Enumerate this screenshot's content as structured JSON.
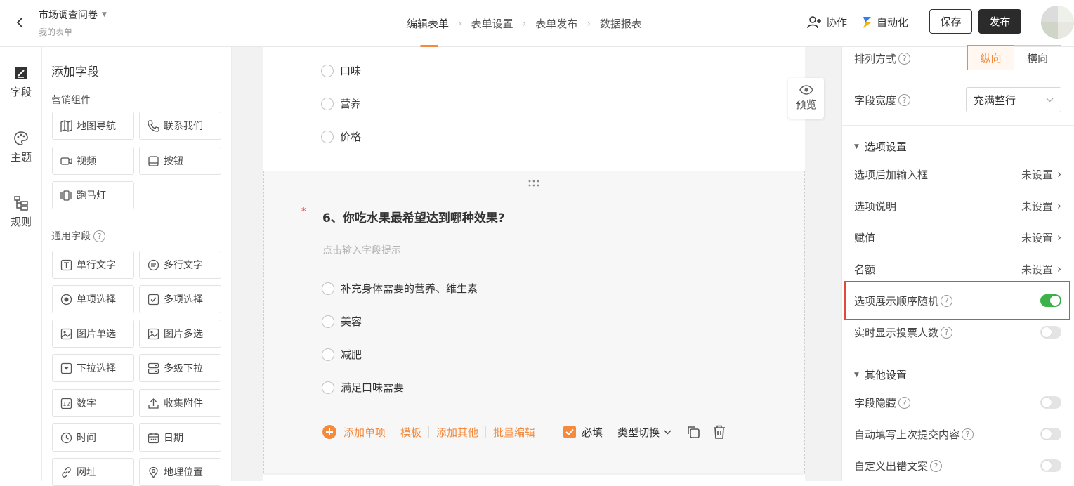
{
  "header": {
    "form_title": "市场调查问卷",
    "form_subtitle": "我的表单",
    "steps": [
      "编辑表单",
      "表单设置",
      "表单发布",
      "数据报表"
    ],
    "collab_label": "协作",
    "automation_label": "自动化",
    "save_label": "保存",
    "publish_label": "发布"
  },
  "rail": {
    "items": [
      "字段",
      "主题",
      "规则"
    ]
  },
  "fields_panel": {
    "title": "添加字段",
    "marketing_label": "营销组件",
    "marketing_items": [
      "地图导航",
      "联系我们",
      "视频",
      "按钮",
      "跑马灯"
    ],
    "general_label": "通用字段",
    "general_items": [
      "单行文字",
      "多行文字",
      "单项选择",
      "多项选择",
      "图片单选",
      "图片多选",
      "下拉选择",
      "多级下拉",
      "数字",
      "收集附件",
      "时间",
      "日期",
      "网址",
      "地理位置"
    ]
  },
  "canvas": {
    "prev_options": [
      "口味",
      "营养",
      "价格"
    ],
    "preview_label": "预览",
    "question_title": "6、你吃水果最希望达到哪种效果?",
    "question_hint": "点击输入字段提示",
    "options": [
      "补充身体需要的营养、维生素",
      "美容",
      "减肥",
      "满足口味需要"
    ],
    "toolbar": {
      "add_option": "添加单项",
      "template": "模板",
      "add_other": "添加其他",
      "batch_edit": "批量编辑",
      "required": "必填",
      "type_switch": "类型切换"
    }
  },
  "props": {
    "arrange_label": "排列方式",
    "arrange_options": [
      "纵向",
      "横向"
    ],
    "width_label": "字段宽度",
    "width_value": "充满整行",
    "option_settings_title": "选项设置",
    "option_rows": [
      {
        "label": "选项后加输入框",
        "value": "未设置"
      },
      {
        "label": "选项说明",
        "value": "未设置"
      },
      {
        "label": "赋值",
        "value": "未设置"
      },
      {
        "label": "名额",
        "value": "未设置"
      }
    ],
    "random_order_label": "选项展示顺序随机",
    "random_order_on": true,
    "live_votes_label": "实时显示投票人数",
    "live_votes_on": false,
    "other_settings_title": "其他设置",
    "other_rows": [
      {
        "label": "字段隐藏",
        "on": false
      },
      {
        "label": "自动填写上次提交内容",
        "on": false
      },
      {
        "label": "自定义出错文案",
        "on": false
      }
    ]
  },
  "colors": {
    "accent": "#f58a3c",
    "toggle_on": "#3bb24a",
    "highlight": "#e04a3c"
  }
}
